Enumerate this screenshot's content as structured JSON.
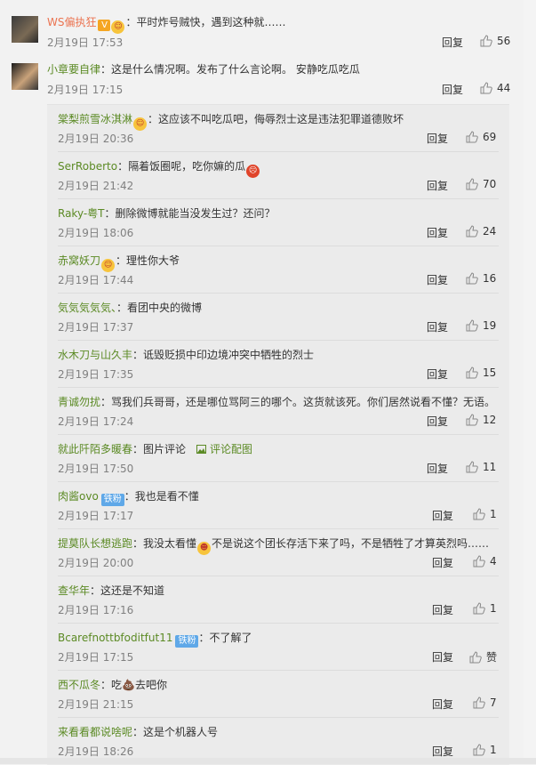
{
  "top_comments": [
    {
      "user": "WS偏执狂",
      "badge": "V",
      "emoji": "☺",
      "text": "：平时炸号贼快，遇到这种就……",
      "date": "2月19日 17:53",
      "reply_label": "回复",
      "likes": "56"
    },
    {
      "user": "小章要自律",
      "text": "：这是什么情况啊。发布了什么言论啊。 安静吃瓜吃瓜",
      "date": "2月19日 17:15",
      "reply_label": "回复",
      "likes": "44"
    }
  ],
  "replies": [
    {
      "user": "棠梨煎雪冰淇淋",
      "emoji": "☺",
      "text": "：这应该不叫吃瓜吧，侮辱烈士这是违法犯罪道德败坏",
      "date": "2月19日 20:36",
      "reply_label": "回复",
      "likes": "69"
    },
    {
      "user": "SerRoberto",
      "text": "：隔着饭圈呢，吃你嫲的瓜",
      "emoji_after": "☹",
      "date": "2月19日 21:42",
      "reply_label": "回复",
      "likes": "70"
    },
    {
      "user": "Raky-粤T",
      "text": "：删除微博就能当没发生过？还问？",
      "date": "2月19日 18:06",
      "reply_label": "回复",
      "likes": "24"
    },
    {
      "user": "赤窝妖刀",
      "emoji": "☺",
      "text": "：理性你大爷",
      "date": "2月19日 17:44",
      "reply_label": "回复",
      "likes": "16"
    },
    {
      "user": "気気気気気、",
      "text": "：看团中央的微博",
      "date": "2月19日 17:37",
      "reply_label": "回复",
      "likes": "19"
    },
    {
      "user": "水木刀与山久丰",
      "text": "：诋毁贬损中印边境冲突中牺牲的烈士",
      "date": "2月19日 17:35",
      "reply_label": "回复",
      "likes": "15"
    },
    {
      "user": "青诚勿扰",
      "text": "：骂我们兵哥哥，还是哪位骂阿三的哪个。这货就该死。你们居然说看不懂？无语。",
      "date": "2月19日 17:24",
      "reply_label": "回复",
      "likes": "12"
    },
    {
      "user": "就此阡陌多暖春",
      "text": "：图片评论",
      "pic_link": "评论配图",
      "date": "2月19日 17:50",
      "reply_label": "回复",
      "likes": "11"
    },
    {
      "user": "肉酱ovo",
      "fan": "铁粉",
      "text": "：我也是看不懂",
      "date": "2月19日 17:17",
      "reply_label": "回复",
      "likes": "1"
    },
    {
      "user": "提莫队长想逃跑",
      "text": "：我没太看懂",
      "emoji_mid": "☻",
      "text2": "不是说这个团长存活下来了吗，不是牺牲了才算英烈吗……",
      "date": "2月19日 20:00",
      "reply_label": "回复",
      "likes": "4"
    },
    {
      "user": "查华年",
      "text": "：这还是不知道",
      "date": "2月19日 17:16",
      "reply_label": "回复",
      "likes": "1"
    },
    {
      "user": "Bcarefnottbfoditfut11",
      "fan": "铁粉",
      "text": "：不了解了",
      "date": "2月19日 17:15",
      "reply_label": "回复",
      "likes": "赞"
    },
    {
      "user": "西不瓜冬",
      "text": "：吃💩去吧你",
      "date": "2月19日 21:15",
      "reply_label": "回复",
      "likes": "7"
    },
    {
      "user": "来看看都说啥呢",
      "text": "：这是个机器人号",
      "date": "2月19日 18:26",
      "reply_label": "回复",
      "likes": "1"
    }
  ],
  "icons": {
    "thumb": "thumb-up-icon",
    "picture": "picture-icon"
  },
  "colors": {
    "username_orange": "#eb7350",
    "username_green": "#5b8a24",
    "fan_badge": "#5fa8e8",
    "vip_badge": "#f5a623"
  }
}
